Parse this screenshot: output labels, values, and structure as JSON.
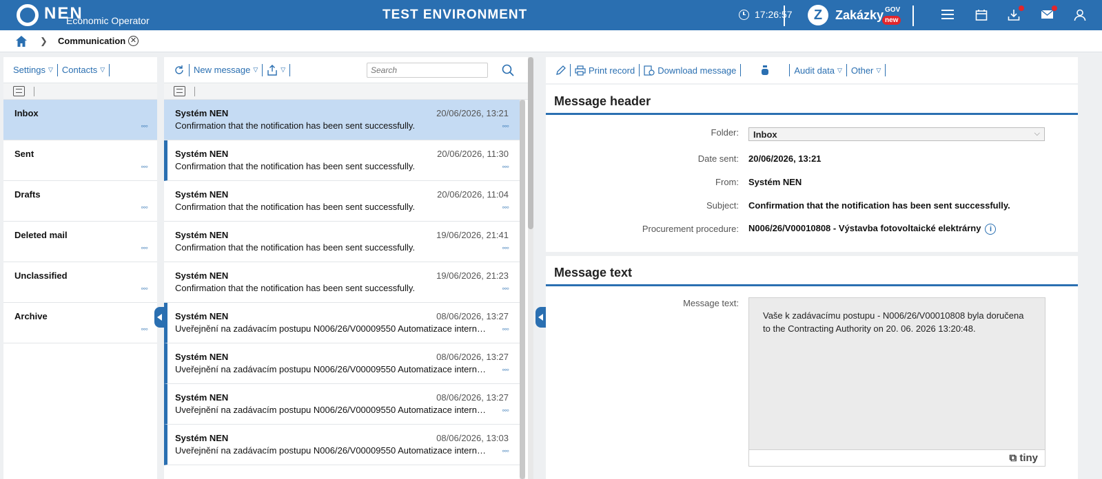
{
  "header": {
    "logo": "NEN",
    "logo_sub": "Economic Operator",
    "environment": "TEST ENVIRONMENT",
    "time": "17:26:57",
    "zakazky": "Zakázky",
    "zakazky_gov": "GOV",
    "zakazky_new": "new",
    "icons": [
      "menu-icon",
      "calendar-icon",
      "download-icon",
      "mail-icon",
      "user-icon"
    ]
  },
  "breadcrumb": {
    "current": "Communication"
  },
  "folders_panel": {
    "toolbar": {
      "settings": "Settings",
      "contacts": "Contacts"
    },
    "folders": [
      {
        "name": "Inbox",
        "active": true
      },
      {
        "name": "Sent"
      },
      {
        "name": "Drafts"
      },
      {
        "name": "Deleted mail"
      },
      {
        "name": "Unclassified"
      },
      {
        "name": "Archive"
      }
    ]
  },
  "messages_panel": {
    "toolbar": {
      "new_message": "New message",
      "search_placeholder": "Search"
    },
    "messages": [
      {
        "from": "Systém NEN",
        "date": "20/06/2026, 13:21",
        "subject": "Confirmation that the notification has been sent successfully.",
        "active": true
      },
      {
        "from": "Systém NEN",
        "date": "20/06/2026, 11:30",
        "subject": "Confirmation that the notification has been sent successfully.",
        "unread": true
      },
      {
        "from": "Systém NEN",
        "date": "20/06/2026, 11:04",
        "subject": "Confirmation that the notification has been sent successfully."
      },
      {
        "from": "Systém NEN",
        "date": "19/06/2026, 21:41",
        "subject": "Confirmation that the notification has been sent successfully."
      },
      {
        "from": "Systém NEN",
        "date": "19/06/2026, 21:23",
        "subject": "Confirmation that the notification has been sent successfully."
      },
      {
        "from": "Systém NEN",
        "date": "08/06/2026, 13:27",
        "subject": "Uveřejnění na zadávacím postupu N006/26/V00009550 Automatizace interníc…",
        "unread": true
      },
      {
        "from": "Systém NEN",
        "date": "08/06/2026, 13:27",
        "subject": "Uveřejnění na zadávacím postupu N006/26/V00009550 Automatizace interníc…",
        "unread": true
      },
      {
        "from": "Systém NEN",
        "date": "08/06/2026, 13:27",
        "subject": "Uveřejnění na zadávacím postupu N006/26/V00009550 Automatizace interníc…",
        "unread": true
      },
      {
        "from": "Systém NEN",
        "date": "08/06/2026, 13:03",
        "subject": "Uveřejnění na zadávacím postupu N006/26/V00009550 Automatizace interníc…",
        "unread": true
      }
    ]
  },
  "detail": {
    "toolbar": {
      "print_record": "Print record",
      "download_message": "Download message",
      "audit_data": "Audit data",
      "other": "Other"
    },
    "header_section": {
      "title": "Message header",
      "folder_label": "Folder:",
      "folder_value": "Inbox",
      "date_label": "Date sent:",
      "date_value": "20/06/2026, 13:21",
      "from_label": "From:",
      "from_value": "Systém NEN",
      "subject_label": "Subject:",
      "subject_value": "Confirmation that the notification has been sent successfully.",
      "procedure_label": "Procurement procedure:",
      "procedure_value": "N006/26/V00010808 - Výstavba fotovoltaické elektrárny"
    },
    "text_section": {
      "title": "Message text",
      "label": "Message text:",
      "line1": "Vaše k zadávacímu postupu - N006/26/V00010808 byla doručena",
      "line2": "to the Contracting Authority on 20. 06. 2026 13:20:48.",
      "editor_brand": "tiny"
    }
  },
  "colors": {
    "brand": "#2a6fb1",
    "selected": "#c5dbf3",
    "badge": "#e3262b"
  }
}
